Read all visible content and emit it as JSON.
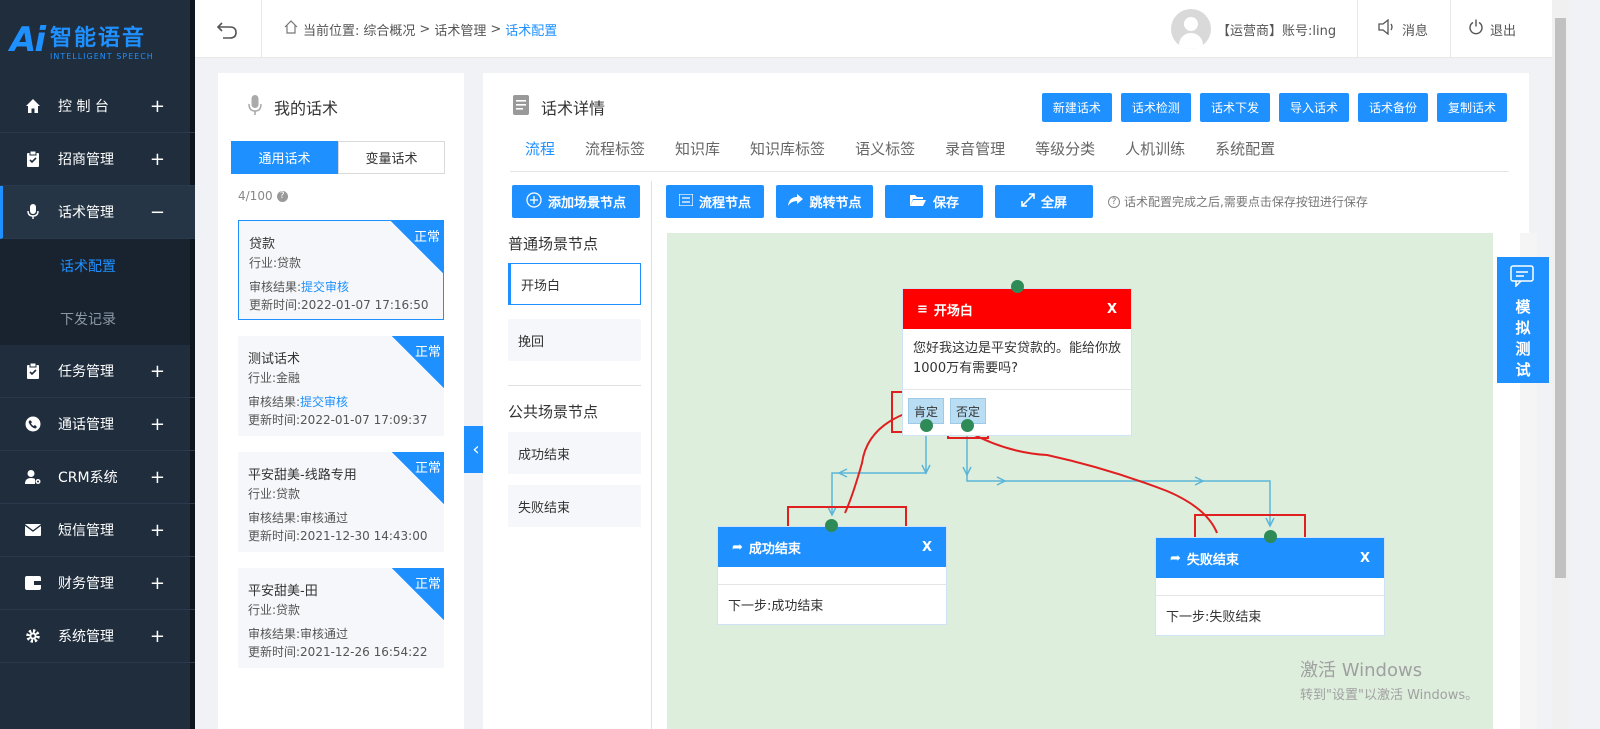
{
  "logo": {
    "mark": "Ai",
    "name": "智能语音",
    "sub": "INTELLIGENT SPEECH"
  },
  "sidebar": {
    "items": [
      {
        "label": "控 制 台",
        "icon": "home-icon",
        "toggle": "+"
      },
      {
        "label": "招商管理",
        "icon": "clipboard-icon",
        "toggle": "+"
      },
      {
        "label": "话术管理",
        "icon": "microphone-icon",
        "toggle": "−"
      },
      {
        "label": "任务管理",
        "icon": "clipboard-check-icon",
        "toggle": "+"
      },
      {
        "label": "通话管理",
        "icon": "phone-circle-icon",
        "toggle": "+"
      },
      {
        "label": "CRM系统",
        "icon": "user-gear-icon",
        "toggle": "+"
      },
      {
        "label": "短信管理",
        "icon": "envelope-icon",
        "toggle": "+"
      },
      {
        "label": "财务管理",
        "icon": "wallet-icon",
        "toggle": "+"
      },
      {
        "label": "系统管理",
        "icon": "gear-icon",
        "toggle": "+"
      }
    ],
    "submenu": [
      "话术配置",
      "下发记录"
    ]
  },
  "header": {
    "crumb_prefix": "当前位置:",
    "crumb_1": "综合概况",
    "crumb_2": "话术管理",
    "crumb_sep": ">",
    "crumb_current": "话术配置",
    "account": "【运营商】账号:ling",
    "messages": "消息",
    "logout": "退出"
  },
  "left_panel": {
    "title": "我的话术",
    "tab_general": "通用话术",
    "tab_variable": "变量话术",
    "count": "4/100",
    "scripts": [
      {
        "name": "贷款",
        "industry": "行业:贷款",
        "audit_label": "审核结果:",
        "audit_value": "提交审核",
        "updated": "更新时间:2022-01-07 17:16:50",
        "status": "正常"
      },
      {
        "name": "测试话术",
        "industry": "行业:金融",
        "audit_label": "审核结果:",
        "audit_value": "提交审核",
        "updated": "更新时间:2022-01-07 17:09:37",
        "status": "正常"
      },
      {
        "name": "平安甜美-线路专用",
        "industry": "行业:贷款",
        "audit_label": "审核结果:",
        "audit_value": "审核通过",
        "updated": "更新时间:2021-12-30 14:43:00",
        "status": "正常"
      },
      {
        "name": "平安甜美-田",
        "industry": "行业:贷款",
        "audit_label": "审核结果:",
        "audit_value": "审核通过",
        "updated": "更新时间:2021-12-26 16:54:22",
        "status": "正常"
      }
    ]
  },
  "main": {
    "title": "话术详情",
    "buttons": [
      "新建话术",
      "话术检测",
      "话术下发",
      "导入话术",
      "话术备份",
      "复制话术"
    ],
    "tabs": [
      "流程",
      "流程标签",
      "知识库",
      "知识库标签",
      "语义标签",
      "录音管理",
      "等级分类",
      "人机训练",
      "系统配置"
    ],
    "add_node": "添加场景节点",
    "normal_section": "普通场景节点",
    "normal_nodes": [
      "开场白",
      "挽回"
    ],
    "public_section": "公共场景节点",
    "public_nodes": [
      "成功结束",
      "失败结束"
    ],
    "toolbar": {
      "flow_node": "流程节点",
      "jump_node": "跳转节点",
      "save": "保存",
      "fullscreen": "全屏"
    },
    "hint": "话术配置完成之后,需要点击保存按钮进行保存"
  },
  "flow": {
    "opening": {
      "title": "开场白",
      "close": "X",
      "content": "您好我这边是平安贷款的。能给你放1000万有需要吗?",
      "branch_yes": "肯定",
      "branch_no": "否定"
    },
    "success": {
      "title": "成功结束",
      "close": "X",
      "next": "下一步:成功结束"
    },
    "fail": {
      "title": "失败结束",
      "close": "X",
      "next": "下一步:失败结束"
    }
  },
  "colors": {
    "accent": "#1e90ff",
    "danger": "#ff0000",
    "sidebar": "#1f2d3d",
    "canvas": "#ddeedd",
    "connector": "#2e8b57"
  },
  "sim_test": "模拟测试",
  "watermark": {
    "line1": "激活 Windows",
    "line2": "转到\"设置\"以激活 Windows。"
  }
}
